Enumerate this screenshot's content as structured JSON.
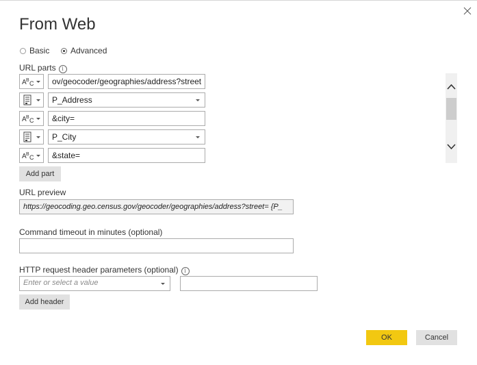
{
  "dialog": {
    "title": "From Web",
    "close_icon": "close-icon"
  },
  "mode": {
    "basic_label": "Basic",
    "advanced_label": "Advanced",
    "selected": "Advanced"
  },
  "url_parts": {
    "label": "URL parts",
    "info_icon": "info-icon",
    "type_icons": {
      "text": "abc-text-icon",
      "parameter": "parameter-icon"
    },
    "rows": [
      {
        "type": "text",
        "value": "ov/geocoder/geographies/address?street="
      },
      {
        "type": "parameter",
        "value": "P_Address"
      },
      {
        "type": "text",
        "value": "&city="
      },
      {
        "type": "parameter",
        "value": "P_City"
      },
      {
        "type": "text",
        "value": "&state="
      }
    ],
    "add_part_label": "Add part"
  },
  "url_preview": {
    "label": "URL preview",
    "value": "https://geocoding.geo.census.gov/geocoder/geographies/address?street= {P_"
  },
  "command_timeout": {
    "label": "Command timeout in minutes (optional)",
    "value": ""
  },
  "http_headers": {
    "label": "HTTP request header parameters (optional)",
    "info_icon": "info-icon",
    "name_placeholder": "Enter or select a value",
    "value": "",
    "add_header_label": "Add header"
  },
  "footer": {
    "ok_label": "OK",
    "cancel_label": "Cancel"
  },
  "colors": {
    "ok_button": "#f2c811",
    "secondary_button": "#e1e1e1",
    "border": "#ababab",
    "scrollbar_track": "#f0f0f0"
  }
}
